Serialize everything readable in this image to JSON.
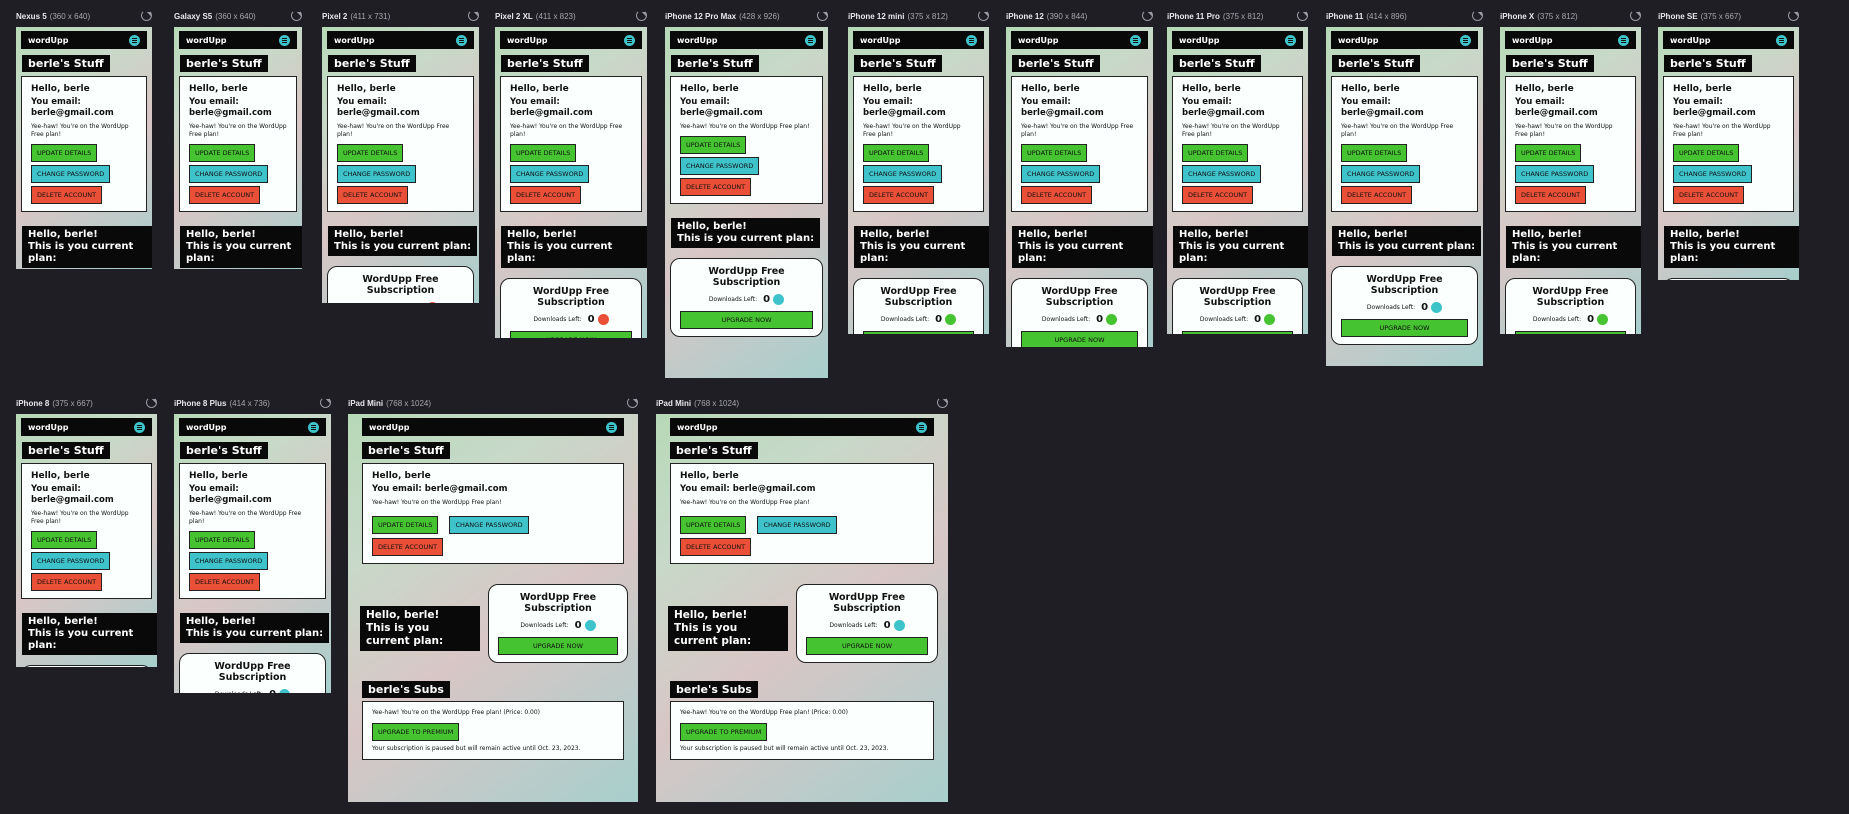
{
  "devices": [
    {
      "name": "Nexus 5",
      "size": "(360 x 640)",
      "variant": "narrow",
      "coin": "red"
    },
    {
      "name": "Galaxy S5",
      "size": "(360 x 640)",
      "variant": "narrow",
      "coin": "red"
    },
    {
      "name": "Pixel 2",
      "size": "(411 x 731)",
      "variant": "wide",
      "coin": "red"
    },
    {
      "name": "Pixel 2 XL",
      "size": "(411 x 823)",
      "variant": "wide",
      "coin": "red"
    },
    {
      "name": "iPhone 12 Pro Max",
      "size": "(428 x 926)",
      "variant": "wide",
      "coin": "teal"
    },
    {
      "name": "iPhone 12 mini",
      "size": "(375 x 812)",
      "variant": "narrow",
      "coin": "green"
    },
    {
      "name": "iPhone 12",
      "size": "(390 x 844)",
      "variant": "narrow",
      "coin": "green"
    },
    {
      "name": "iPhone 11 Pro",
      "size": "(375 x 812)",
      "variant": "narrow",
      "coin": "green"
    },
    {
      "name": "iPhone 11",
      "size": "(414 x 896)",
      "variant": "wide",
      "coin": "teal"
    },
    {
      "name": "iPhone X",
      "size": "(375 x 812)",
      "variant": "narrow",
      "coin": "green"
    },
    {
      "name": "iPhone SE",
      "size": "(375 x 667)",
      "variant": "narrow",
      "coin": "teal"
    },
    {
      "name": "iPhone 8",
      "size": "(375 x 667)",
      "variant": "narrow",
      "coin": "teal"
    },
    {
      "name": "iPhone 8 Plus",
      "size": "(414 x 736)",
      "variant": "wide",
      "coin": "teal"
    },
    {
      "name": "iPad Mini",
      "size": "(768 x 1024)",
      "variant": "tablet",
      "coin": "teal"
    },
    {
      "name": "iPad Mini",
      "size": "(768 x 1024)",
      "variant": "tablet",
      "coin": "teal"
    }
  ],
  "app": {
    "logo": "wordUpp",
    "page_title": "berle's Stuff",
    "hello": "Hello, berle",
    "email_label": "You email:",
    "email": "berle@gmail.com",
    "email_full": "You email: berle@gmail.com",
    "plan_text": "Yee-haw! You're on the WordUpp Free plan!",
    "update_details": "UPDATE DETAILS",
    "change_password": "CHANGE PASSWORD",
    "delete_account": "DELETE ACCOUNT",
    "plan_hello": "Hello, berle!",
    "plan_current": "This is you current plan:",
    "sub_title": "WordUpp Free Subscription",
    "downloads_label": "Downloads Left:",
    "downloads_value": "0",
    "upgrade_now": "UPGRADE NOW",
    "subs_title": "berle's Subs",
    "subs_plan": "Yee-haw! You're on the WordUpp Free plan! (Price: 0.00)",
    "upgrade_premium": "UPGRADE TO PREMIUM",
    "subs_note": "Your subscription is paused but will remain active until Oct. 23, 2023."
  },
  "colors": {
    "green": "#46c331",
    "teal": "#3ec3cb",
    "red": "#ea4f37",
    "nav": "#090909"
  }
}
